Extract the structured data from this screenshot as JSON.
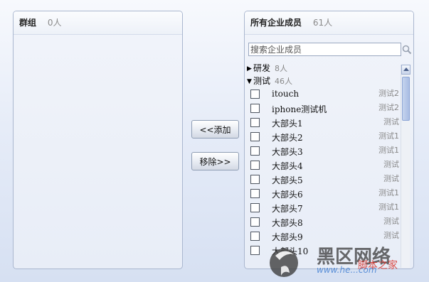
{
  "left_panel": {
    "title": "群组",
    "count": "0人"
  },
  "right_panel": {
    "title": "所有企业成员",
    "count": "61人",
    "search": {
      "placeholder": "搜索企业成员",
      "value": ""
    },
    "groups": [
      {
        "name": "研发",
        "count": "8人",
        "expanded": false
      },
      {
        "name": "测试",
        "count": "46人",
        "expanded": true
      }
    ],
    "members": [
      {
        "name": "itouch",
        "group": "测试2"
      },
      {
        "name": "iphone测试机",
        "group": "测试2"
      },
      {
        "name": "大部头1",
        "group": "测试"
      },
      {
        "name": "大部头2",
        "group": "测试1"
      },
      {
        "name": "大部头3",
        "group": "测试1"
      },
      {
        "name": "大部头4",
        "group": "测试"
      },
      {
        "name": "大部头5",
        "group": "测试"
      },
      {
        "name": "大部头6",
        "group": "测试1"
      },
      {
        "name": "大部头7",
        "group": "测试1"
      },
      {
        "name": "大部头8",
        "group": "测试"
      },
      {
        "name": "大部头9",
        "group": "测试"
      },
      {
        "name": "大部头10",
        "group": ""
      }
    ]
  },
  "buttons": {
    "add_label": "<<添加",
    "remove_label": "移除>>"
  },
  "watermark": {
    "site_name": "黑区网络",
    "tagline": "脚本之家",
    "url": "www.he...com"
  },
  "icons": {
    "search": "search-icon",
    "collapsed": "caret-right-icon",
    "expanded": "caret-down-icon"
  },
  "colors": {
    "panel_border": "#aab7cf",
    "background": "#e6ecf8",
    "muted_text": "#888888",
    "scroll_thumb": "#a9bde3"
  }
}
